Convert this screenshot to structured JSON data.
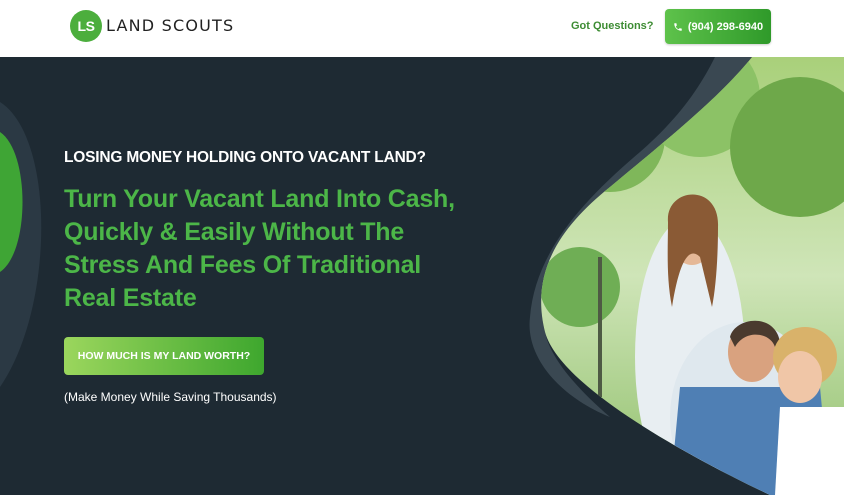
{
  "header": {
    "logo_initials": "LS",
    "logo_text": "LAND SCOUTS",
    "questions_link": "Got Questions?",
    "phone_number": "(904) 298-6940"
  },
  "hero": {
    "kicker": "LOSING MONEY HOLDING ONTO VACANT LAND?",
    "headline": "Turn Your Vacant Land Into Cash, Quickly & Easily Without The Stress And Fees Of Traditional Real Estate",
    "cta_label": "HOW MUCH IS MY LAND WORTH?",
    "subnote": "(Make Money While Saving Thousands)"
  },
  "icons": {
    "phone": "phone-icon",
    "hero_image": "family-outdoors-photo"
  },
  "colors": {
    "brand_green": "#4cae3d",
    "headline_green": "#4cb648",
    "hero_background": "#1e2a33",
    "header_background": "#ffffff"
  }
}
